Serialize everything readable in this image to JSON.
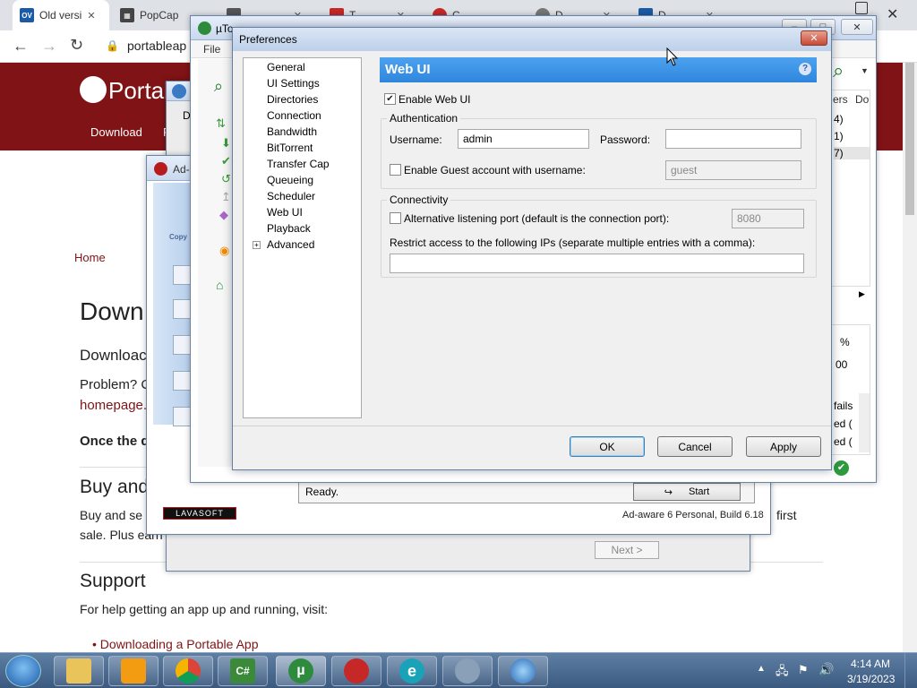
{
  "browser": {
    "tabs": [
      {
        "label": "Old versi",
        "fav": "OV",
        "fav_color": "#1a5aa6"
      },
      {
        "label": "PopCap",
        "fav": "",
        "fav_color": "#444"
      },
      {
        "label": "",
        "fav": "",
        "fav_color": "#555"
      },
      {
        "label": "T",
        "fav": "",
        "fav_color": "#c62828"
      },
      {
        "label": "C",
        "fav": "",
        "fav_color": "#c62828"
      },
      {
        "label": "D",
        "fav": "",
        "fav_color": "#777"
      },
      {
        "label": "D",
        "fav": "",
        "fav_color": "#1a5aa6"
      }
    ],
    "address": "portableap",
    "site": {
      "logo": "Portab",
      "nav_download": "Download",
      "nav_f": "F",
      "breadcrumb": "Home",
      "heading": "Down",
      "p1": "Downloac",
      "p2": "Problem? C",
      "p2_link": "homepage.",
      "p3": "Once the d",
      "h_buy": "Buy and",
      "buy_text1": "Buy and se",
      "buy_text2": "sale. Plus earn",
      "first": "first",
      "h_support": "Support",
      "support_text": "For help getting an app up and running, visit:",
      "support_link": "Downloading a Portable App"
    }
  },
  "adaware": {
    "title": "Ad-",
    "copy": "Copy",
    "status": "Ready.",
    "start": "Start",
    "brand": "LAVASOFT",
    "build": "Ad-aware 6 Personal, Build 6.18"
  },
  "setup": {
    "d": "D",
    "next": "Next >"
  },
  "utorrent": {
    "title": "µTo",
    "menu_file": "File",
    "cols": [
      "ers",
      "Do"
    ],
    "vals": [
      "4)",
      "1)",
      "7)"
    ],
    "pct": "%",
    "num": "00",
    "side_words": [
      "fails",
      "ed (",
      "ed ("
    ]
  },
  "prefs": {
    "title": "Preferences",
    "tree": [
      "General",
      "UI Settings",
      "Directories",
      "Connection",
      "Bandwidth",
      "BitTorrent",
      "Transfer Cap",
      "Queueing",
      "Scheduler",
      "Web UI",
      "Playback",
      "Advanced"
    ],
    "panel_title": "Web UI",
    "enable_web_ui": "Enable Web UI",
    "auth_group": "Authentication",
    "username_label": "Username:",
    "username_value": "admin",
    "password_label": "Password:",
    "password_value": "",
    "guest_label": "Enable Guest account with username:",
    "guest_value": "guest",
    "connectivity_group": "Connectivity",
    "alt_port_label": "Alternative listening port (default is the connection port):",
    "alt_port_value": "8080",
    "restrict_label": "Restrict access to the following IPs (separate multiple entries with a comma):",
    "restrict_value": "",
    "ok": "OK",
    "cancel": "Cancel",
    "apply": "Apply"
  },
  "taskbar": {
    "time": "4:14 AM",
    "date": "3/19/2023",
    "items": [
      "explorer",
      "media-player",
      "chrome",
      "csharp",
      "utorrent",
      "app6",
      "ie-edge",
      "app8",
      "app9"
    ]
  }
}
